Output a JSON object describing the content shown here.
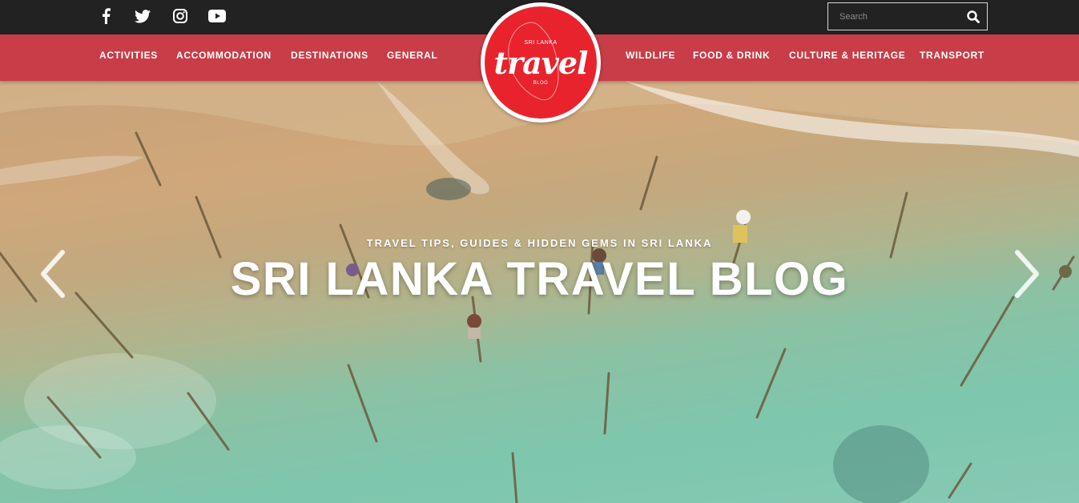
{
  "topbar": {
    "social": [
      {
        "name": "facebook-icon",
        "glyph": "f"
      },
      {
        "name": "twitter-icon",
        "glyph": "twitter"
      },
      {
        "name": "instagram-icon",
        "glyph": "instagram"
      },
      {
        "name": "youtube-icon",
        "glyph": "youtube"
      }
    ],
    "search": {
      "placeholder": "Search",
      "icon": "search-icon"
    }
  },
  "nav": {
    "left": [
      "ACTIVITIES",
      "ACCOMMODATION",
      "DESTINATIONS",
      "GENERAL"
    ],
    "right": [
      "WILDLIFE",
      "FOOD & DRINK",
      "CULTURE & HERITAGE",
      "TRANSPORT"
    ]
  },
  "logo": {
    "top": "SRI LANKA",
    "script": "travel",
    "bottom": "BLOG",
    "color": "#e8232d"
  },
  "hero": {
    "subtitle": "TRAVEL TIPS, GUIDES & HIDDEN GEMS IN SRI LANKA",
    "title": "SRI LANKA TRAVEL BLOG",
    "prev_icon": "chevron-left-icon",
    "next_icon": "chevron-right-icon"
  },
  "colors": {
    "topbar": "#222222",
    "nav": "#c83d47",
    "text": "#ffffff"
  }
}
